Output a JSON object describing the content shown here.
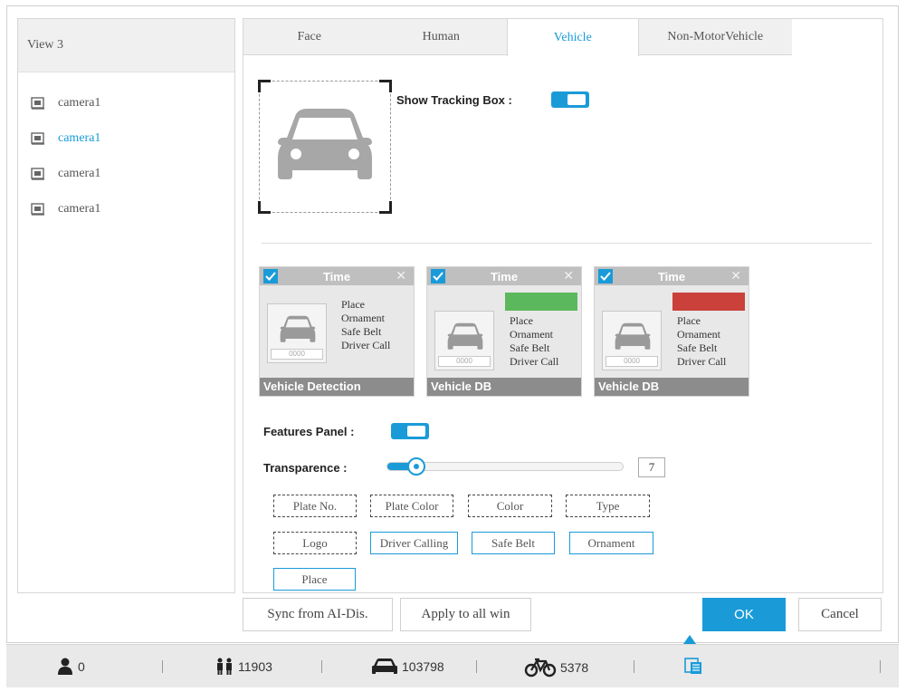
{
  "left_panel": {
    "title": "View 3",
    "cameras": [
      {
        "label": "camera1",
        "active": false
      },
      {
        "label": "camera1",
        "active": true
      },
      {
        "label": "camera1",
        "active": false
      },
      {
        "label": "camera1",
        "active": false
      }
    ]
  },
  "tabs": [
    {
      "label": "Face",
      "active": false
    },
    {
      "label": "Human",
      "active": false
    },
    {
      "label": "Vehicle",
      "active": true
    },
    {
      "label": "Non-MotorVehicle",
      "active": false
    }
  ],
  "tracking": {
    "label": "Show Tracking Box :",
    "enabled": true
  },
  "preview_cards": [
    {
      "header": "Time",
      "attrs": [
        "Place",
        "Ornament",
        "Safe Belt",
        "Driver Call"
      ],
      "badge": null,
      "plate": "0000",
      "footer": "Vehicle Detection"
    },
    {
      "header": "Time",
      "attrs": [
        "Place",
        "Ornament",
        "Safe Belt",
        "Driver Call"
      ],
      "badge": {
        "color": "#5cb85c"
      },
      "plate": "0000",
      "footer": "Vehicle DB"
    },
    {
      "header": "Time",
      "attrs": [
        "Place",
        "Ornament",
        "Safe Belt",
        "Driver Call"
      ],
      "badge": {
        "color": "#c9413a"
      },
      "plate": "0000",
      "footer": "Vehicle DB"
    }
  ],
  "features_panel": {
    "label": "Features Panel :",
    "enabled": true
  },
  "transparence": {
    "label": "Transparence :",
    "value": "7",
    "fraction": 0.1
  },
  "features": [
    {
      "label": "Plate No.",
      "selected": false
    },
    {
      "label": "Plate Color",
      "selected": false
    },
    {
      "label": "Color",
      "selected": false
    },
    {
      "label": "Type",
      "selected": false
    },
    {
      "label": "Logo",
      "selected": false
    },
    {
      "label": "Driver Calling",
      "selected": true
    },
    {
      "label": "Safe Belt",
      "selected": true
    },
    {
      "label": "Ornament",
      "selected": true
    },
    {
      "label": "Place",
      "selected": true
    }
  ],
  "buttons": {
    "sync": "Sync from AI-Dis.",
    "apply_all": "Apply to all win",
    "ok": "OK",
    "cancel": "Cancel"
  },
  "status_bar": {
    "face_count": "0",
    "human_count": "11903",
    "vehicle_count": "103798",
    "bike_count": "5378"
  },
  "colors": {
    "accent": "#1a9bd8"
  }
}
